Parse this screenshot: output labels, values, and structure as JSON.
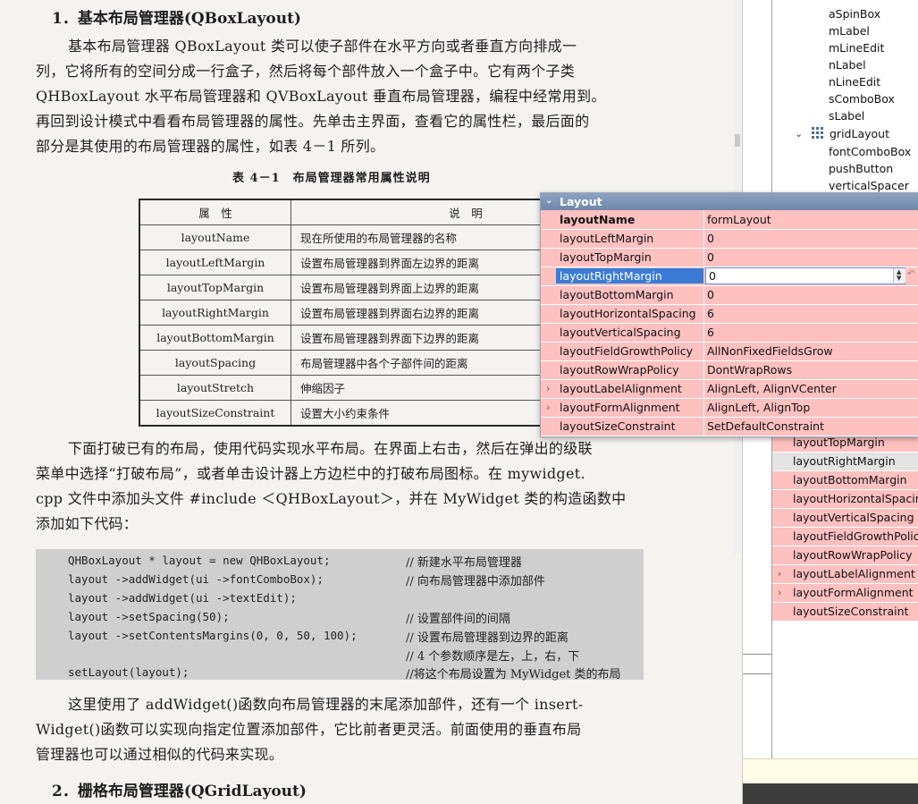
{
  "book": {
    "heading1": "1．基本布局管理器(QBoxLayout)",
    "paragraph1": [
      "基本布局管理器 QBoxLayout 类可以使子部件在水平方向或者垂直方向排成一",
      "列，它将所有的空间分成一行盒子，然后将每个部件放入一个盒子中。它有两个子类",
      "QHBoxLayout 水平布局管理器和 QVBoxLayout 垂直布局管理器，编程中经常用到。",
      "再回到设计模式中看看布局管理器的属性。先单击主界面，查看它的属性栏，最后面的",
      "部分是其使用的布局管理器的属性，如表 4－1 所列。"
    ],
    "table_caption": "表 4－1　布局管理器常用属性说明",
    "table_header": [
      "属　性",
      "说　明"
    ],
    "table_rows": [
      [
        "layoutName",
        "现在所使用的布局管理器的名称"
      ],
      [
        "layoutLeftMargin",
        "设置布局管理器到界面左边界的距离"
      ],
      [
        "layoutTopMargin",
        "设置布局管理器到界面上边界的距离"
      ],
      [
        "layoutRightMargin",
        "设置布局管理器到界面右边界的距离"
      ],
      [
        "layoutBottomMargin",
        "设置布局管理器到界面下边界的距离"
      ],
      [
        "layoutSpacing",
        "布局管理器中各个子部件间的距离"
      ],
      [
        "layoutStretch",
        "伸缩因子"
      ],
      [
        "layoutSizeConstraint",
        "设置大小约束条件"
      ]
    ],
    "paragraph2": [
      "下面打破已有的布局，使用代码实现水平布局。在界面上右击，然后在弹出的级联",
      "菜单中选择“打破布局”，或者单击设计器上方边栏中的打破布局图标。在 mywidget.",
      "cpp 文件中添加头文件 #include ＜QHBoxLayout＞，并在 MyWidget 类的构造函数中",
      "添加如下代码："
    ],
    "code_lines": [
      {
        "code": "QHBoxLayout * layout = new QHBoxLayout;",
        "comment": "// 新建水平布局管理器"
      },
      {
        "code": "layout ->addWidget(ui ->fontComboBox);",
        "comment": "// 向布局管理器中添加部件"
      },
      {
        "code": "layout ->addWidget(ui ->textEdit);",
        "comment": ""
      },
      {
        "code": "layout ->setSpacing(50);",
        "comment": "// 设置部件间的间隔"
      },
      {
        "code": "layout ->setContentsMargins(0, 0, 50, 100);",
        "comment": "// 设置布局管理器到边界的距离"
      },
      {
        "code": "",
        "comment": "// 4 个参数顺序是左，上，右，下"
      },
      {
        "code": "setLayout(layout);",
        "comment": "//将这个布局设置为 MyWidget 类的布局"
      }
    ],
    "paragraph3": [
      "这里使用了 addWidget()函数向布局管理器的末尾添加部件，还有一个 insert-",
      "Widget()函数可以实现向指定位置添加部件，它比前者更灵活。前面使用的垂直布局",
      "管理器也可以通过相似的代码来实现。"
    ],
    "heading2": "2．栅格布局管理器(QGridLayout)"
  },
  "object_tree": {
    "items": [
      "aSpinBox",
      "mLabel",
      "mLineEdit",
      "nLabel",
      "nLineEdit",
      "sComboBox",
      "sLabel"
    ],
    "grid_layout_label": "gridLayout",
    "grid_children": [
      "fontComboBox",
      "pushButton",
      "verticalSpacer"
    ]
  },
  "popup": {
    "header": "Layout",
    "rows": [
      {
        "name": "layoutName",
        "value": "formLayout"
      },
      {
        "name": "layoutLeftMargin",
        "value": "0"
      },
      {
        "name": "layoutTopMargin",
        "value": "0"
      },
      {
        "name": "layoutRightMargin",
        "value": "0"
      },
      {
        "name": "layoutBottomMargin",
        "value": "0"
      },
      {
        "name": "layoutHorizontalSpacing",
        "value": "6"
      },
      {
        "name": "layoutVerticalSpacing",
        "value": "6"
      },
      {
        "name": "layoutFieldGrowthPolicy",
        "value": "AllNonFixedFieldsGrow"
      },
      {
        "name": "layoutRowWrapPolicy",
        "value": "DontWrapRows"
      },
      {
        "name": "layoutLabelAlignment",
        "value": "AlignLeft, AlignVCenter"
      },
      {
        "name": "layoutFormAlignment",
        "value": "AlignLeft, AlignTop"
      },
      {
        "name": "layoutSizeConstraint",
        "value": "SetDefaultConstraint"
      }
    ]
  },
  "background_props": [
    "layoutTopMargin",
    "layoutRightMargin",
    "layoutBottomMargin",
    "layoutHorizontalSpacing",
    "layoutVerticalSpacing",
    "layoutFieldGrowthPolicy",
    "layoutRowWrapPolicy",
    "layoutLabelAlignment",
    "layoutFormAlignment",
    "layoutSizeConstraint"
  ],
  "colors": {
    "property_row": "#ffc0c0",
    "selection": "#3a7bd5",
    "header": "#7b90b3"
  }
}
